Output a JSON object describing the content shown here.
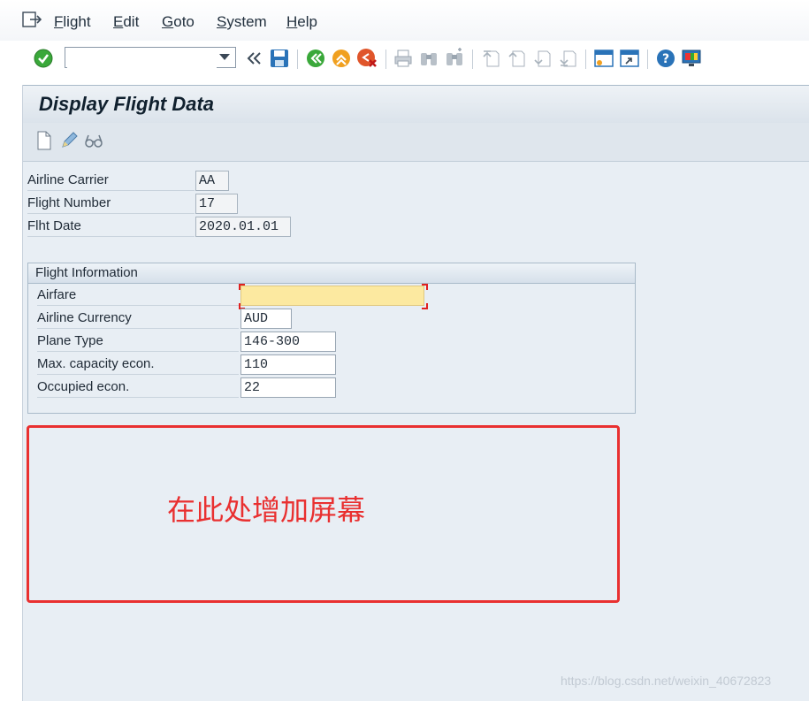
{
  "menu": {
    "items": [
      {
        "first": "F",
        "rest": "light"
      },
      {
        "first": "E",
        "rest": "dit"
      },
      {
        "first": "G",
        "rest": "oto"
      },
      {
        "first": "S",
        "rest": "ystem"
      },
      {
        "first": "H",
        "rest": "elp"
      }
    ]
  },
  "toolbar": {
    "command_value": "",
    "icons": [
      "enter-check-icon",
      "command-field",
      "collapse-icon",
      "save-icon",
      "back-icon",
      "exit-icon",
      "cancel-icon",
      "print-icon",
      "find-icon",
      "find-next-icon",
      "first-page-icon",
      "previous-page-icon",
      "next-page-icon",
      "last-page-icon",
      "create-session-icon",
      "shortcut-icon",
      "help-icon",
      "customize-layout-icon"
    ]
  },
  "screen": {
    "title": "Display Flight Data",
    "app_toolbar_icons": [
      "create-document-icon",
      "edit-pencil-icon",
      "display-glasses-icon"
    ]
  },
  "header_fields": {
    "carrier": {
      "label": "Airline Carrier",
      "value": "AA"
    },
    "flight_number": {
      "label": "Flight Number",
      "value": "17"
    },
    "flight_date": {
      "label": "Flht Date",
      "value": "2020.01.01"
    }
  },
  "flight_info": {
    "title": "Flight Information",
    "airfare": {
      "label": "Airfare",
      "value": ""
    },
    "currency": {
      "label": "Airline Currency",
      "value": "AUD"
    },
    "plane_type": {
      "label": "Plane Type",
      "value": "146-300"
    },
    "max_capacity": {
      "label": "Max. capacity econ.",
      "value": "110"
    },
    "occupied": {
      "label": "Occupied econ.",
      "value": "22"
    }
  },
  "annotation": {
    "text": "在此处增加屏幕",
    "color": "#e93030"
  },
  "watermark": "https://blog.csdn.net/weixin_40672823",
  "colors": {
    "screen_bg": "#e8eef4",
    "required_field": "#fce9a0",
    "accent_blue": "#1f6eb8"
  }
}
